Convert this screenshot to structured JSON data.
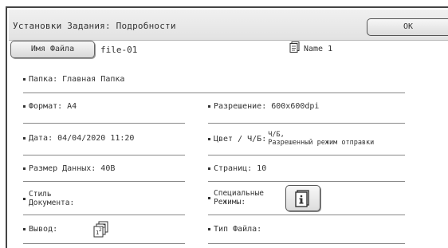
{
  "header": {
    "title": "Установки Задания: Подробности",
    "ok_label": "OK"
  },
  "file": {
    "button_label": "Имя Файла",
    "value": "file-01",
    "name_label": "Name 1"
  },
  "fields": {
    "folder": "Папка: Главная Папка",
    "format": "Формат: A4",
    "resolution": "Разрешение: 600x600dpi",
    "date": "Дата: 04/04/2020 11:20",
    "color_label": "Цвет / Ч/Б:",
    "color_value_1": "Ч/Б,",
    "color_value_2": "Разрешенный режим отправки",
    "data_size": "Размер Данных: 40B",
    "pages": "Страниц: 10",
    "doc_style_1": "Стиль",
    "doc_style_2": "Документа:",
    "special_1": "Специальные",
    "special_2": "Режимы:",
    "output": "Вывод:",
    "file_type": "Тип Файла:"
  },
  "icons": {
    "name": "document-name-icon",
    "special": "info-icon",
    "output": "collate-output-icon"
  }
}
